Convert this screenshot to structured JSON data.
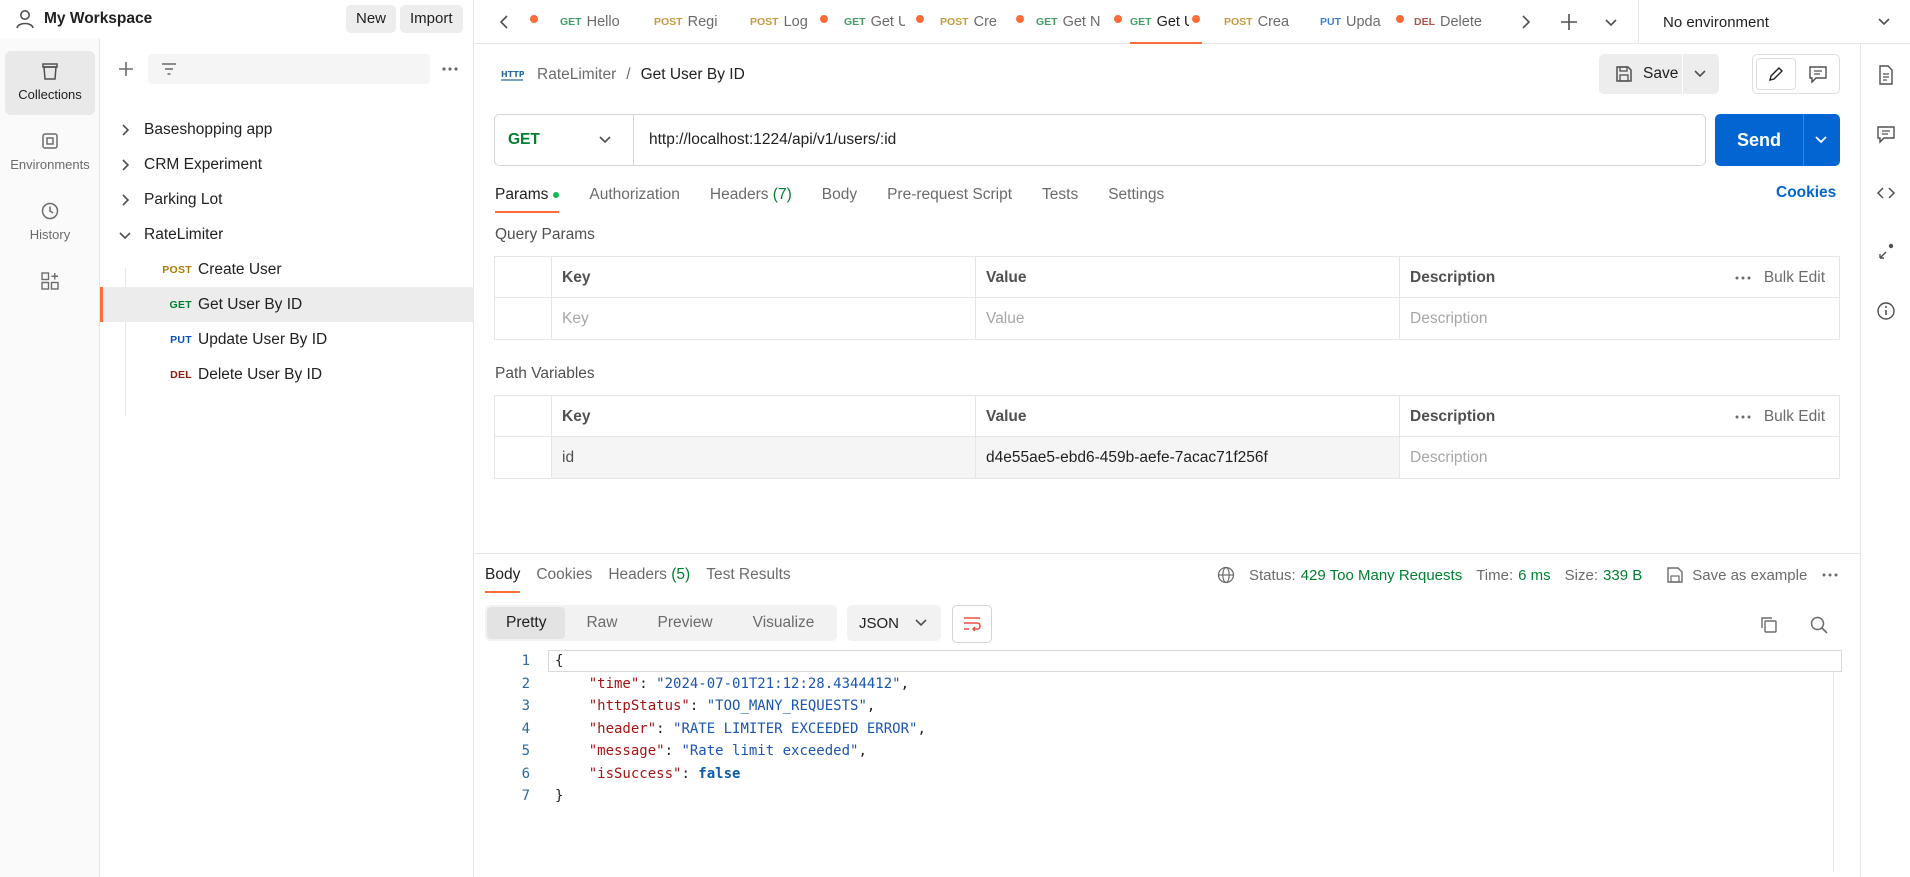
{
  "workspace": {
    "name": "My Workspace",
    "new_label": "New",
    "import_label": "Import"
  },
  "rail": [
    {
      "label": "Collections",
      "icon": "collections-icon",
      "active": true
    },
    {
      "label": "Environments",
      "icon": "environments-icon",
      "active": false
    },
    {
      "label": "History",
      "icon": "history-icon",
      "active": false
    }
  ],
  "collections": [
    {
      "name": "Baseshopping app",
      "expanded": false
    },
    {
      "name": "CRM Experiment",
      "expanded": false
    },
    {
      "name": "Parking Lot",
      "expanded": false
    },
    {
      "name": "RateLimiter",
      "expanded": true
    }
  ],
  "requests": [
    {
      "method": "POST",
      "name": "Create User",
      "selected": false
    },
    {
      "method": "GET",
      "name": "Get User By ID",
      "selected": true
    },
    {
      "method": "PUT",
      "name": "Update User By ID",
      "selected": false
    },
    {
      "method": "DEL",
      "name": "Delete User By ID",
      "selected": false
    }
  ],
  "tabs": [
    {
      "method": "",
      "title": "",
      "dirty": true
    },
    {
      "method": "GET",
      "title": "Hello",
      "dirty": false
    },
    {
      "method": "POST",
      "title": "Regi",
      "dirty": false
    },
    {
      "method": "POST",
      "title": "Log",
      "dirty": true
    },
    {
      "method": "GET",
      "title": "Get U",
      "dirty": true
    },
    {
      "method": "POST",
      "title": "Cre",
      "dirty": true
    },
    {
      "method": "GET",
      "title": "Get N",
      "dirty": true
    },
    {
      "method": "GET",
      "title": "Get U",
      "dirty": true,
      "active": true
    },
    {
      "method": "POST",
      "title": "Crea",
      "dirty": false
    },
    {
      "method": "PUT",
      "title": "Upda",
      "dirty": true
    },
    {
      "method": "DEL",
      "title": "Delete",
      "dirty": false
    }
  ],
  "environment": {
    "selected": "No environment"
  },
  "breadcrumb": {
    "collection": "RateLimiter",
    "separator": "/",
    "request": "Get User By ID"
  },
  "save_label": "Save",
  "request": {
    "method": "GET",
    "url": "http://localhost:1224/api/v1/users/:id",
    "send_label": "Send"
  },
  "request_tabs": [
    {
      "label": "Params",
      "active": true,
      "indicator": true
    },
    {
      "label": "Authorization"
    },
    {
      "label": "Headers",
      "count": "(7)"
    },
    {
      "label": "Body"
    },
    {
      "label": "Pre-request Script"
    },
    {
      "label": "Tests"
    },
    {
      "label": "Settings"
    }
  ],
  "cookies_label": "Cookies",
  "query_params": {
    "title": "Query Params",
    "headers": {
      "key": "Key",
      "value": "Value",
      "description": "Description",
      "bulk": "Bulk Edit"
    },
    "placeholders": {
      "key": "Key",
      "value": "Value",
      "description": "Description"
    }
  },
  "path_variables": {
    "title": "Path Variables",
    "headers": {
      "key": "Key",
      "value": "Value",
      "description": "Description",
      "bulk": "Bulk Edit"
    },
    "rows": [
      {
        "key": "id",
        "value": "d4e55ae5-ebd6-459b-aefe-7acac71f256f",
        "description_placeholder": "Description"
      }
    ]
  },
  "response_tabs": [
    {
      "label": "Body",
      "active": true
    },
    {
      "label": "Cookies"
    },
    {
      "label": "Headers",
      "count": "(5)"
    },
    {
      "label": "Test Results"
    }
  ],
  "response_meta": {
    "status_label": "Status:",
    "status_value": "429 Too Many Requests",
    "time_label": "Time:",
    "time_value": "6 ms",
    "size_label": "Size:",
    "size_value": "339 B",
    "save_example": "Save as example"
  },
  "view_modes": [
    {
      "label": "Pretty",
      "active": true
    },
    {
      "label": "Raw"
    },
    {
      "label": "Preview"
    },
    {
      "label": "Visualize"
    }
  ],
  "format": "JSON",
  "response_body": [
    {
      "n": "1",
      "parts": [
        {
          "t": "{",
          "c": "p"
        }
      ]
    },
    {
      "n": "2",
      "parts": [
        {
          "t": "    ",
          "c": "p"
        },
        {
          "t": "\"time\"",
          "c": "k"
        },
        {
          "t": ": ",
          "c": "p"
        },
        {
          "t": "\"2024-07-01T21:12:28.4344412\"",
          "c": "s"
        },
        {
          "t": ",",
          "c": "p"
        }
      ]
    },
    {
      "n": "3",
      "parts": [
        {
          "t": "    ",
          "c": "p"
        },
        {
          "t": "\"httpStatus\"",
          "c": "k"
        },
        {
          "t": ": ",
          "c": "p"
        },
        {
          "t": "\"TOO_MANY_REQUESTS\"",
          "c": "s"
        },
        {
          "t": ",",
          "c": "p"
        }
      ]
    },
    {
      "n": "4",
      "parts": [
        {
          "t": "    ",
          "c": "p"
        },
        {
          "t": "\"header\"",
          "c": "k"
        },
        {
          "t": ": ",
          "c": "p"
        },
        {
          "t": "\"RATE LIMITER EXCEEDED ERROR\"",
          "c": "s"
        },
        {
          "t": ",",
          "c": "p"
        }
      ]
    },
    {
      "n": "5",
      "parts": [
        {
          "t": "    ",
          "c": "p"
        },
        {
          "t": "\"message\"",
          "c": "k"
        },
        {
          "t": ": ",
          "c": "p"
        },
        {
          "t": "\"Rate limit exceeded\"",
          "c": "s"
        },
        {
          "t": ",",
          "c": "p"
        }
      ]
    },
    {
      "n": "6",
      "parts": [
        {
          "t": "    ",
          "c": "p"
        },
        {
          "t": "\"isSuccess\"",
          "c": "k"
        },
        {
          "t": ": ",
          "c": "p"
        },
        {
          "t": "false",
          "c": "b"
        }
      ]
    },
    {
      "n": "7",
      "parts": [
        {
          "t": "}",
          "c": "p"
        }
      ]
    }
  ],
  "colors": {
    "accent": "#ff6c37",
    "primary": "#0265d2",
    "get": "#007f31",
    "post": "#ad7a03",
    "put": "#0053b8",
    "delete": "#8e1a10"
  }
}
